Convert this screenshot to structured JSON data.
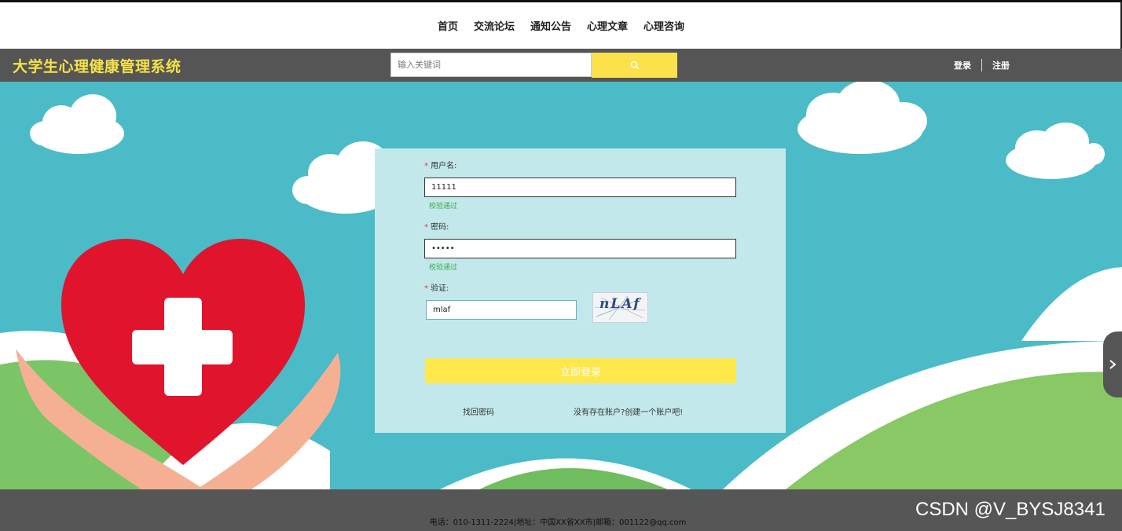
{
  "nav": {
    "items": [
      "首页",
      "交流论坛",
      "通知公告",
      "心理文章",
      "心理咨询"
    ]
  },
  "header": {
    "brand": "大学生心理健康管理系统",
    "search_placeholder": "输入关键词",
    "search_icon": "search-icon",
    "login": "登录",
    "register": "注册"
  },
  "form": {
    "username": {
      "label": "用户名:",
      "value": "11111",
      "status": "校验通过"
    },
    "password": {
      "label": "密码:",
      "value": "•••••",
      "status": "校验通过"
    },
    "captcha": {
      "label": "验证:",
      "value": "mlaf",
      "image_text": "nLAf"
    },
    "required_mark": "*",
    "submit": "立即登录",
    "forgot": "找回密码",
    "create": "没有存在账户?创建一个账户吧!"
  },
  "footer": {
    "info": "电话：010-1311-2224|地址：中国XX省XX市|邮箱：001122@qq.com",
    "watermark": "CSDN @V_BYSJ8341"
  },
  "colors": {
    "accent": "#fbe14c",
    "header_bg": "#555555",
    "sky": "#4abbc7",
    "panel": "#c2e8ec",
    "ok": "#3cab47"
  }
}
